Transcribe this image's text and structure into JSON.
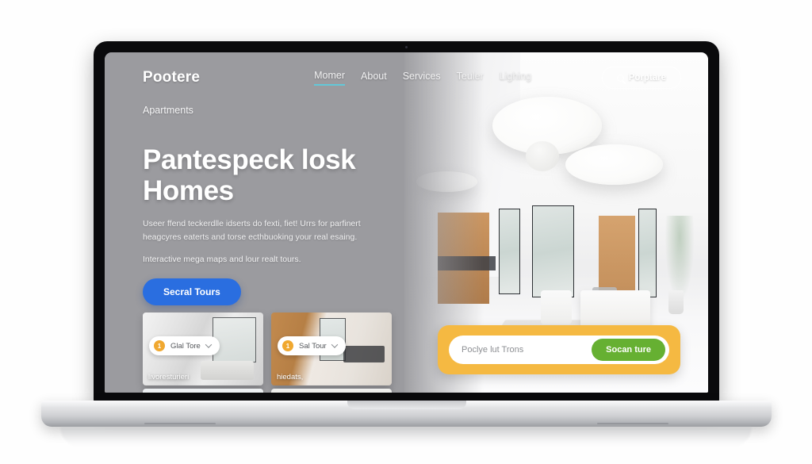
{
  "site": {
    "brand": "Pootere",
    "subbrand": "Apartments",
    "nav": {
      "links": [
        {
          "label": "Momer",
          "active": true
        },
        {
          "label": "About",
          "active": false
        },
        {
          "label": "Services",
          "active": false
        },
        {
          "label": "Teuler",
          "active": false
        },
        {
          "label": "Lighing",
          "active": false
        }
      ],
      "search_button": "Porptare",
      "search_icon": "search-icon",
      "active_underline_color": "#63c8d8"
    },
    "hero": {
      "headline_line1": "Pantespeck losk",
      "headline_line2": "Homes",
      "subcopy": "Useer ffend teckerdlle idserts do fexti, fiet! Urrs for parfinert heagcyres eaterts and torse ecthbuoking your real esaing.",
      "subcopy_2": "Interactive mega maps and lour realt tours.",
      "cta_label": "Secral Tours",
      "cta_color": "#2a6ee0"
    },
    "cards": [
      {
        "pill_badge": "1",
        "pill_label": "Glal Tore",
        "caption": "livoresturieri",
        "chevron_icon": "chevron-down-icon"
      },
      {
        "pill_badge": "1",
        "pill_label": "Sal Tour",
        "caption": "hiedats,",
        "chevron_icon": "chevron-down-icon"
      }
    ],
    "search_bar": {
      "placeholder": "Poclye lut Trons",
      "button_label": "Socan ture",
      "bar_color": "#f5b942",
      "button_color": "#66b032"
    }
  }
}
